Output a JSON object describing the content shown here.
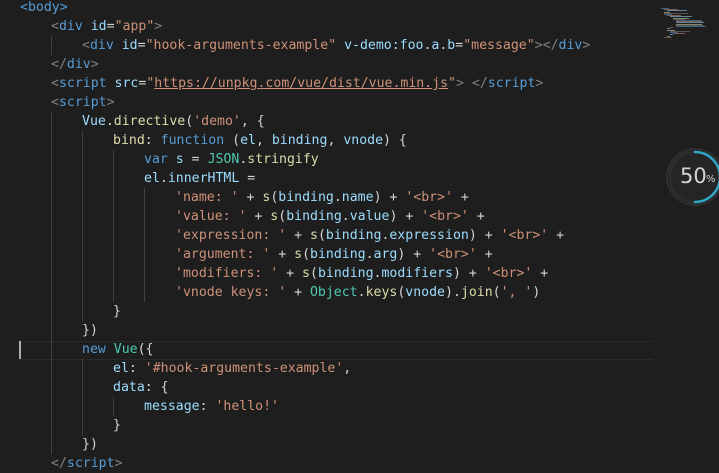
{
  "colors": {
    "background": "#1e1e1e",
    "tag": "#569cd6",
    "attribute": "#9cdcfe",
    "string": "#ce9178",
    "function": "#dcdcaa",
    "class": "#4ec9b0",
    "punctuation": "#808080",
    "zoom_arc": "#2ea7c7"
  },
  "editor": {
    "lines": [
      [
        [
          "tag",
          "<body>"
        ]
      ],
      [
        [
          "punct",
          "<"
        ],
        [
          "tag",
          "div"
        ],
        [
          "plain",
          " "
        ],
        [
          "attr",
          "id"
        ],
        [
          "plain",
          "="
        ],
        [
          "str",
          "\"app\""
        ],
        [
          "punct",
          ">"
        ]
      ],
      [
        [
          "punct",
          "<"
        ],
        [
          "tag",
          "div"
        ],
        [
          "plain",
          " "
        ],
        [
          "attr",
          "id"
        ],
        [
          "plain",
          "="
        ],
        [
          "str",
          "\"hook-arguments-example\""
        ],
        [
          "plain",
          " "
        ],
        [
          "attr",
          "v-demo:foo.a.b"
        ],
        [
          "plain",
          "="
        ],
        [
          "str",
          "\"message\""
        ],
        [
          "punct",
          ">"
        ],
        [
          "punct",
          "</"
        ],
        [
          "tag",
          "div"
        ],
        [
          "punct",
          ">"
        ]
      ],
      [
        [
          "punct",
          "</"
        ],
        [
          "tag",
          "div"
        ],
        [
          "punct",
          ">"
        ]
      ],
      [
        [
          "punct",
          "<"
        ],
        [
          "tag",
          "script"
        ],
        [
          "plain",
          " "
        ],
        [
          "attr",
          "src"
        ],
        [
          "plain",
          "="
        ],
        [
          "str",
          "\""
        ],
        [
          "url",
          "https://unpkg.com/vue/dist/vue.min.js"
        ],
        [
          "str",
          "\""
        ],
        [
          "punct",
          ">"
        ],
        [
          "plain",
          " "
        ],
        [
          "punct",
          "</"
        ],
        [
          "tag",
          "script"
        ],
        [
          "punct",
          ">"
        ]
      ],
      [
        [
          "punct",
          "<"
        ],
        [
          "tag",
          "script"
        ],
        [
          "punct",
          ">"
        ]
      ],
      [
        [
          "var",
          "Vue"
        ],
        [
          "plain",
          "."
        ],
        [
          "fn",
          "directive"
        ],
        [
          "plain",
          "("
        ],
        [
          "str",
          "'demo'"
        ],
        [
          "plain",
          ", {"
        ]
      ],
      [
        [
          "fn",
          "bind"
        ],
        [
          "plain",
          ": "
        ],
        [
          "kw",
          "function"
        ],
        [
          "plain",
          " ("
        ],
        [
          "var",
          "el"
        ],
        [
          "plain",
          ", "
        ],
        [
          "var",
          "binding"
        ],
        [
          "plain",
          ", "
        ],
        [
          "var",
          "vnode"
        ],
        [
          "plain",
          ") {"
        ]
      ],
      [
        [
          "kw",
          "var"
        ],
        [
          "plain",
          " "
        ],
        [
          "var",
          "s"
        ],
        [
          "plain",
          " = "
        ],
        [
          "cls",
          "JSON"
        ],
        [
          "plain",
          "."
        ],
        [
          "fn",
          "stringify"
        ]
      ],
      [
        [
          "var",
          "el"
        ],
        [
          "plain",
          "."
        ],
        [
          "var",
          "innerHTML"
        ],
        [
          "plain",
          " ="
        ]
      ],
      [
        [
          "str",
          "'name: '"
        ],
        [
          "plain",
          " + "
        ],
        [
          "fn",
          "s"
        ],
        [
          "plain",
          "("
        ],
        [
          "var",
          "binding"
        ],
        [
          "plain",
          "."
        ],
        [
          "var",
          "name"
        ],
        [
          "plain",
          ") + "
        ],
        [
          "str",
          "'<br>'"
        ],
        [
          "plain",
          " +"
        ]
      ],
      [
        [
          "str",
          "'value: '"
        ],
        [
          "plain",
          " + "
        ],
        [
          "fn",
          "s"
        ],
        [
          "plain",
          "("
        ],
        [
          "var",
          "binding"
        ],
        [
          "plain",
          "."
        ],
        [
          "var",
          "value"
        ],
        [
          "plain",
          ") + "
        ],
        [
          "str",
          "'<br>'"
        ],
        [
          "plain",
          " +"
        ]
      ],
      [
        [
          "str",
          "'expression: '"
        ],
        [
          "plain",
          " + "
        ],
        [
          "fn",
          "s"
        ],
        [
          "plain",
          "("
        ],
        [
          "var",
          "binding"
        ],
        [
          "plain",
          "."
        ],
        [
          "var",
          "expression"
        ],
        [
          "plain",
          ") + "
        ],
        [
          "str",
          "'<br>'"
        ],
        [
          "plain",
          " +"
        ]
      ],
      [
        [
          "str",
          "'argument: '"
        ],
        [
          "plain",
          " + "
        ],
        [
          "fn",
          "s"
        ],
        [
          "plain",
          "("
        ],
        [
          "var",
          "binding"
        ],
        [
          "plain",
          "."
        ],
        [
          "var",
          "arg"
        ],
        [
          "plain",
          ") + "
        ],
        [
          "str",
          "'<br>'"
        ],
        [
          "plain",
          " +"
        ]
      ],
      [
        [
          "str",
          "'modifiers: '"
        ],
        [
          "plain",
          " + "
        ],
        [
          "fn",
          "s"
        ],
        [
          "plain",
          "("
        ],
        [
          "var",
          "binding"
        ],
        [
          "plain",
          "."
        ],
        [
          "var",
          "modifiers"
        ],
        [
          "plain",
          ") + "
        ],
        [
          "str",
          "'<br>'"
        ],
        [
          "plain",
          " +"
        ]
      ],
      [
        [
          "str",
          "'vnode keys: '"
        ],
        [
          "plain",
          " + "
        ],
        [
          "cls",
          "Object"
        ],
        [
          "plain",
          "."
        ],
        [
          "fn",
          "keys"
        ],
        [
          "plain",
          "("
        ],
        [
          "var",
          "vnode"
        ],
        [
          "plain",
          ")."
        ],
        [
          "fn",
          "join"
        ],
        [
          "plain",
          "("
        ],
        [
          "str",
          "', '"
        ],
        [
          "plain",
          ")"
        ]
      ],
      [
        [
          "plain",
          "}"
        ]
      ],
      [
        [
          "plain",
          "})"
        ]
      ],
      [
        [
          "kw",
          "new"
        ],
        [
          "plain",
          " "
        ],
        [
          "cls",
          "Vue"
        ],
        [
          "plain",
          "({"
        ]
      ],
      [
        [
          "var",
          "el"
        ],
        [
          "plain",
          ": "
        ],
        [
          "str",
          "'#hook-arguments-example'"
        ],
        [
          "plain",
          ","
        ]
      ],
      [
        [
          "var",
          "data"
        ],
        [
          "plain",
          ": {"
        ]
      ],
      [
        [
          "var",
          "message"
        ],
        [
          "plain",
          ": "
        ],
        [
          "str",
          "'hello!'"
        ]
      ],
      [
        [
          "plain",
          "}"
        ]
      ],
      [
        [
          "plain",
          "})"
        ]
      ],
      [
        [
          "punct",
          "</"
        ],
        [
          "tag",
          "script"
        ],
        [
          "punct",
          ">"
        ]
      ]
    ]
  },
  "zoom": {
    "value": "50",
    "unit": "%",
    "level": 0.5
  }
}
